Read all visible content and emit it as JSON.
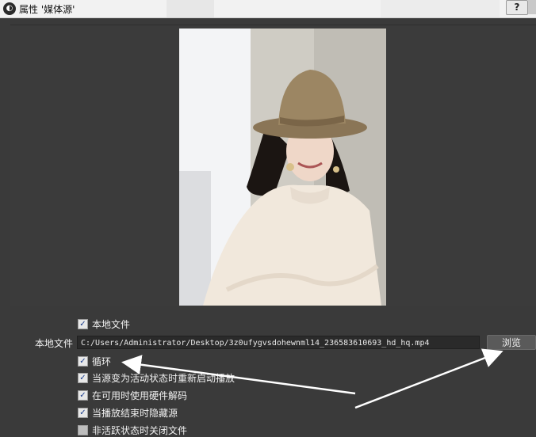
{
  "window": {
    "title": "属性 '媒体源'",
    "help_label": "?"
  },
  "preview": {
    "image_description_icon": "photo-preview"
  },
  "properties": {
    "local_file_checkbox": {
      "label": "本地文件",
      "checked": true
    },
    "local_file_label": "本地文件",
    "local_file_path": "C:/Users/Administrator/Desktop/3z0ufygvsdohewnml14_236583610693_hd_hq.mp4",
    "browse_label": "浏览",
    "options": [
      {
        "label": "循环",
        "checked": true
      },
      {
        "label": "当源变为活动状态时重新启动播放",
        "checked": true
      },
      {
        "label": "在可用时使用硬件解码",
        "checked": true
      },
      {
        "label": "当播放结束时隐藏源",
        "checked": true
      },
      {
        "label": "非活跃状态时关闭文件",
        "checked": false
      }
    ]
  },
  "annotations": {
    "arrow_color": "#ffffff"
  }
}
